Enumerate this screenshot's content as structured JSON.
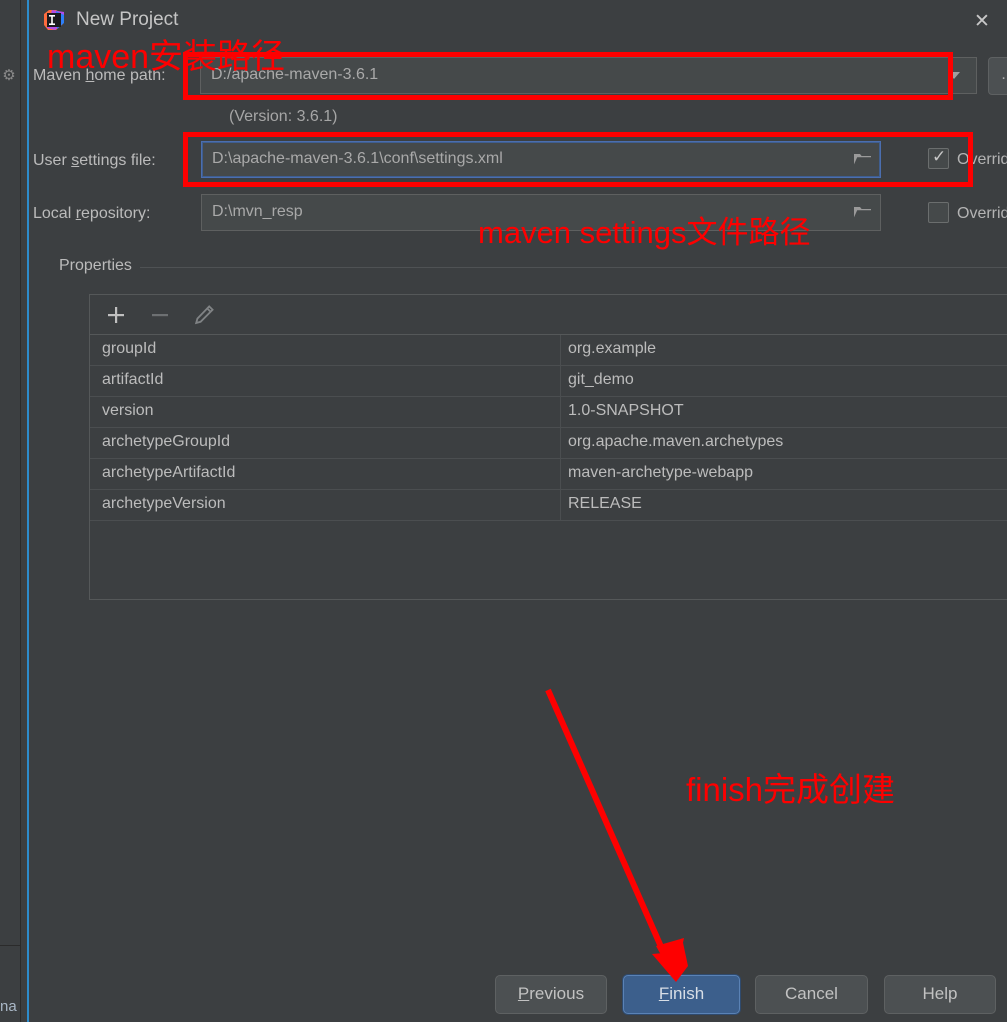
{
  "window": {
    "title": "New Project",
    "app_icon": "intellij-idea-icon",
    "close_icon": "close-icon"
  },
  "background": {
    "gear_icon": "gear-icon",
    "partial_text": "na"
  },
  "form": {
    "maven_home": {
      "label_pre": "Maven ",
      "label_mnemonic": "h",
      "label_post": "ome path:",
      "value": "D:/apache-maven-3.6.1",
      "dropdown_icon": "chevron-down-icon",
      "browse_label": "...",
      "version_note": "(Version: 3.6.1)"
    },
    "user_settings": {
      "label_pre": "User ",
      "label_mnemonic": "s",
      "label_post": "ettings file:",
      "value": "D:\\apache-maven-3.6.1\\conf\\settings.xml",
      "folder_icon": "folder-icon",
      "override_label": "Override",
      "override_checked": true
    },
    "local_repository": {
      "label_pre": "Local ",
      "label_mnemonic": "r",
      "label_post": "epository:",
      "value": "D:\\mvn_resp",
      "folder_icon": "folder-icon",
      "override_label": "Override",
      "override_checked": false
    }
  },
  "properties": {
    "group_title": "Properties",
    "toolbar": {
      "add_icon": "plus-icon",
      "remove_icon": "minus-icon",
      "edit_icon": "pencil-icon"
    },
    "rows": [
      {
        "key": "groupId",
        "value": "org.example"
      },
      {
        "key": "artifactId",
        "value": "git_demo"
      },
      {
        "key": "version",
        "value": "1.0-SNAPSHOT"
      },
      {
        "key": "archetypeGroupId",
        "value": "org.apache.maven.archetypes"
      },
      {
        "key": "archetypeArtifactId",
        "value": "maven-archetype-webapp"
      },
      {
        "key": "archetypeVersion",
        "value": "RELEASE"
      }
    ]
  },
  "buttons": {
    "previous": {
      "pre": "",
      "mnemonic": "P",
      "post": "revious"
    },
    "finish": {
      "pre": "",
      "mnemonic": "F",
      "post": "inish"
    },
    "cancel": {
      "pre": "Cancel",
      "mnemonic": "",
      "post": ""
    },
    "help": {
      "pre": "Help",
      "mnemonic": "",
      "post": ""
    }
  },
  "annotations": {
    "maven_install_path": "maven安装路径",
    "maven_settings_path": "maven settings文件路径",
    "finish_note": "finish完成创建",
    "color": "#fe0000"
  }
}
